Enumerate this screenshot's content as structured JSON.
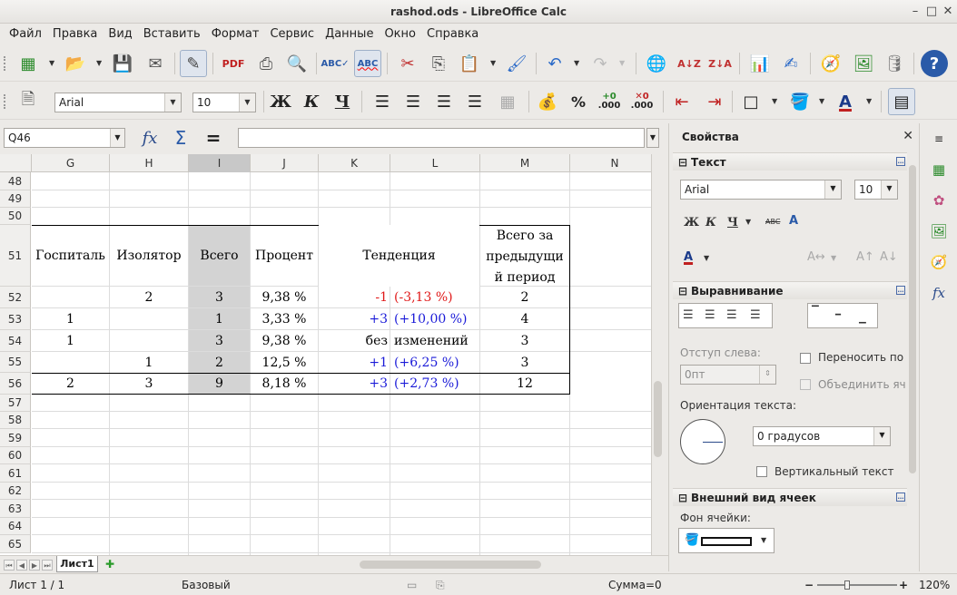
{
  "window": {
    "title": "rashod.ods - LibreOffice Calc"
  },
  "menu": [
    "Файл",
    "Правка",
    "Вид",
    "Вставить",
    "Формат",
    "Сервис",
    "Данные",
    "Окно",
    "Справка"
  ],
  "toolbar2": {
    "font": "Arial",
    "size": "10",
    "bold": "Ж",
    "italic": "К",
    "underline": "Ч",
    "percent": "%",
    "add_decimal": ".000",
    "del_decimal": ".000"
  },
  "formula": {
    "cell_ref": "Q46",
    "content": "",
    "fx": "fx",
    "sum": "Σ",
    "eq": "="
  },
  "columns": [
    "G",
    "H",
    "I",
    "J",
    "K",
    "L",
    "M",
    "N"
  ],
  "rows": [
    "48",
    "49",
    "50",
    "51",
    "52",
    "53",
    "54",
    "55",
    "56",
    "57",
    "58",
    "59",
    "60",
    "61",
    "62",
    "63",
    "64",
    "65"
  ],
  "table": {
    "headers": {
      "g": "Госпиталь",
      "h": "Изолятор",
      "i": "Всего",
      "j": "Процент",
      "kl": "Тенденция",
      "m1": "Всего за",
      "m2": "предыдущи",
      "m3": "й период"
    },
    "r52": {
      "h": "2",
      "i": "3",
      "j": "9,38 %",
      "k": "-1",
      "l": "(-3,13 %)",
      "m": "2"
    },
    "r53": {
      "g": "1",
      "i": "1",
      "j": "3,33 %",
      "k": "+3",
      "l": "(+10,00 %)",
      "m": "4"
    },
    "r54": {
      "g": "1",
      "i": "3",
      "j": "9,38 %",
      "k": "без",
      "l": "изменений",
      "m": "3"
    },
    "r55": {
      "h": "1",
      "i": "2",
      "j": "12,5 %",
      "k": "+1",
      "l": "(+6,25 %)",
      "m": "3"
    },
    "r56": {
      "g": "2",
      "h": "3",
      "i": "9",
      "j": "8,18 %",
      "k": "+3",
      "l": "(+2,73 %)",
      "m": "12"
    }
  },
  "sheets": {
    "tab": "Лист1"
  },
  "sidebar": {
    "title": "Свойства",
    "text_section": "Текст",
    "font": "Arial",
    "size": "10",
    "bold": "Ж",
    "italic": "К",
    "underline": "Ч",
    "strike": "ABC",
    "align_section": "Выравнивание",
    "indent_label": "Отступ слева:",
    "indent_value": "0пт",
    "wrap_label": "Переносить по",
    "merge_label": "Объединить яч",
    "orient_label": "Ориентация текста:",
    "orient_value": "0 градусов",
    "vertical_label": "Вертикальный текст",
    "appearance_section": "Внешний вид ячеек",
    "bg_label": "Фон ячейки:"
  },
  "status": {
    "sheet": "Лист 1 / 1",
    "style": "Базовый",
    "sum": "Сумма=0",
    "zoom": "120%"
  }
}
